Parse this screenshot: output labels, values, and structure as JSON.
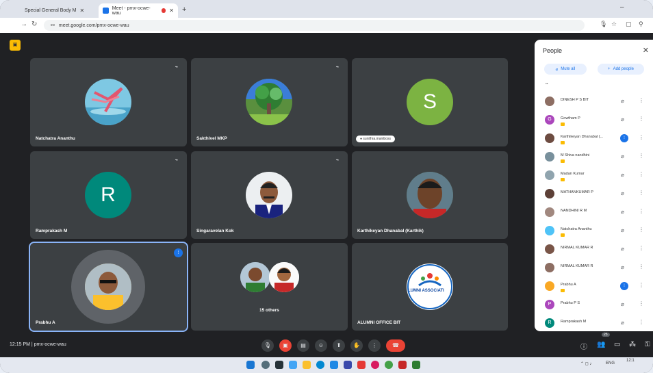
{
  "browser": {
    "tabs": [
      {
        "label": "Special General Body M"
      },
      {
        "label": "Meet - pmx-ocwe-wau"
      }
    ],
    "url": "meet.google.com/pmx-ocwe-wau"
  },
  "meeting": {
    "code": "pmx-ocwe-wau",
    "time": "12:15 PM",
    "separator": "|",
    "tiles": [
      {
        "name": "Natchatra Ananthu",
        "avatar_type": "flamingo"
      },
      {
        "name": "Sakthivel MKP",
        "avatar_type": "tree"
      },
      {
        "name": "",
        "letter": "S",
        "chip": "sunithra.maniboss",
        "color": "#7cb342"
      },
      {
        "name": "Ramprakash M",
        "letter": "R",
        "color": "#00897b"
      },
      {
        "name": "Singaravelan Kok",
        "avatar_type": "person"
      },
      {
        "name": "Karthikeyan Dhanabal (Karthik)",
        "avatar_type": "person2"
      },
      {
        "name": "Prabhu A",
        "avatar_type": "person3",
        "speaking": true
      },
      {
        "name": "",
        "others": "15 others"
      },
      {
        "name": "ALUMNI OFFICE BIT",
        "avatar_type": "logo",
        "logo_text": "LUMNI ASSOCIATI"
      }
    ]
  },
  "people_panel": {
    "title": "People",
    "mute_all": "Mute all",
    "add_people": "Add people",
    "section": "••",
    "participants": [
      {
        "name": "DINESH P S BIT",
        "host": false,
        "speaking": false,
        "initial": "",
        "color": "#8d6e63"
      },
      {
        "name": "Gowtham P",
        "host": true,
        "speaking": false,
        "initial": "G",
        "color": "#ab47bc"
      },
      {
        "name": "Karthikeyan Dhanabal (...",
        "host": true,
        "speaking": true,
        "initial": "",
        "color": "#6d4c41"
      },
      {
        "name": "M Shiva nandhini",
        "host": true,
        "speaking": false,
        "initial": "",
        "color": "#78909c"
      },
      {
        "name": "Madan Kumar",
        "host": true,
        "speaking": false,
        "initial": "",
        "color": "#90a4ae"
      },
      {
        "name": "MATHANKUMAR P",
        "host": false,
        "speaking": false,
        "initial": "",
        "color": "#5d4037"
      },
      {
        "name": "NANDHINI R M",
        "host": false,
        "speaking": false,
        "initial": "",
        "color": "#a1887f"
      },
      {
        "name": "Natchatra Ananthu",
        "host": true,
        "speaking": false,
        "initial": "",
        "color": "#4fc3f7"
      },
      {
        "name": "NIRMAL KUMAR R",
        "host": false,
        "speaking": false,
        "initial": "",
        "color": "#795548"
      },
      {
        "name": "NIRMAL KUMAR R",
        "host": false,
        "speaking": false,
        "initial": "",
        "color": "#8d6e63"
      },
      {
        "name": "Prabhu A",
        "host": true,
        "speaking": true,
        "initial": "",
        "color": "#f9a825"
      },
      {
        "name": "Prabhu P S",
        "host": false,
        "speaking": false,
        "initial": "P",
        "color": "#ab47bc"
      },
      {
        "name": "Ramprakash M",
        "host": false,
        "speaking": false,
        "initial": "R",
        "color": "#00897b"
      }
    ]
  },
  "bottom": {
    "people_count": "25"
  },
  "taskbar": {
    "lang": "ENG",
    "time": "12:1"
  }
}
